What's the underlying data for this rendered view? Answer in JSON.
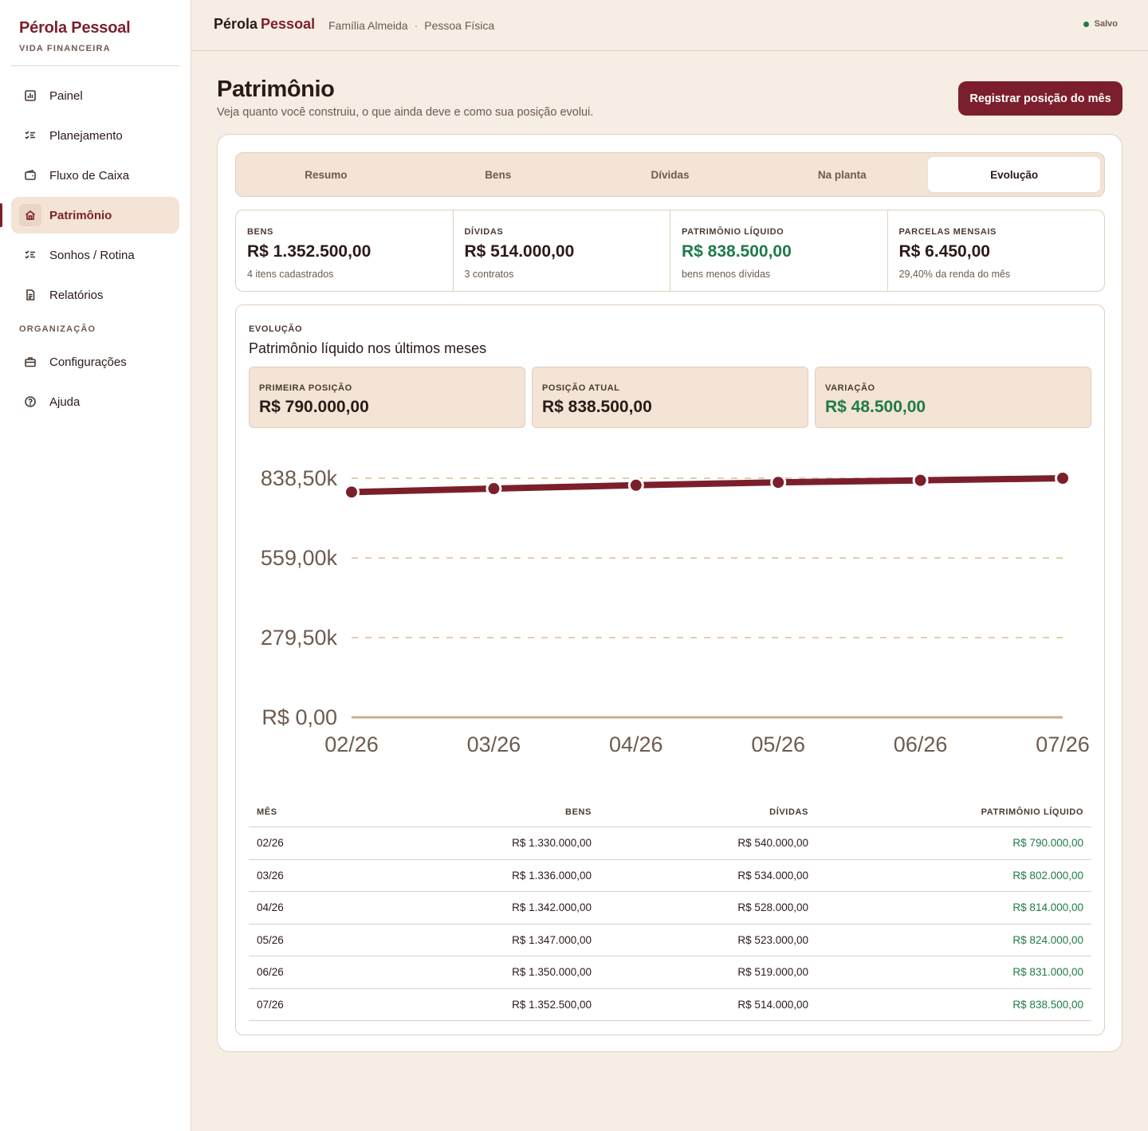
{
  "brand": {
    "name": "Pérola Pessoal",
    "subtitle": "VIDA FINANCEIRA"
  },
  "sidebar": {
    "items": [
      {
        "label": "Painel",
        "icon": "chart-bar-icon"
      },
      {
        "label": "Planejamento",
        "icon": "checklist-icon"
      },
      {
        "label": "Fluxo de Caixa",
        "icon": "wallet-icon"
      },
      {
        "label": "Patrimônio",
        "icon": "home-icon",
        "active": true
      },
      {
        "label": "Sonhos / Rotina",
        "icon": "checklist-icon"
      },
      {
        "label": "Relatórios",
        "icon": "document-icon"
      }
    ],
    "section_label": "ORGANIZAÇÃO",
    "org_items": [
      {
        "label": "Configurações",
        "icon": "briefcase-icon"
      },
      {
        "label": "Ajuda",
        "icon": "help-circle-icon"
      }
    ]
  },
  "topbar": {
    "title_part1": "Pérola",
    "title_part2": "Pessoal",
    "crumb1": "Família Almeida",
    "separator": "·",
    "crumb2": "Pessoa Física",
    "status": "Salvo"
  },
  "page": {
    "title": "Patrimônio",
    "subtitle": "Veja quanto você construiu, o que ainda deve e como sua posição evolui.",
    "primary_action": "Registrar posição do mês"
  },
  "tabs": [
    "Resumo",
    "Bens",
    "Dívidas",
    "Na planta",
    "Evolução"
  ],
  "active_tab": "Evolução",
  "kpis": [
    {
      "label": "BENS",
      "value": "R$ 1.352.500,00",
      "note": "4 itens cadastrados"
    },
    {
      "label": "DÍVIDAS",
      "value": "R$ 514.000,00",
      "note": "3 contratos"
    },
    {
      "label": "PATRIMÔNIO LÍQUIDO",
      "value": "R$ 838.500,00",
      "note": "bens menos dívidas"
    },
    {
      "label": "PARCELAS MENSAIS",
      "value": "R$ 6.450,00",
      "note": "29,40% da renda do mês"
    }
  ],
  "evolution": {
    "eyebrow": "EVOLUÇÃO",
    "title": "Patrimônio líquido nos últimos meses",
    "stats": [
      {
        "label": "PRIMEIRA POSIÇÃO",
        "value": "R$ 790.000,00"
      },
      {
        "label": "POSIÇÃO ATUAL",
        "value": "R$ 838.500,00"
      },
      {
        "label": "VARIAÇÃO",
        "value": "R$ 48.500,00"
      }
    ]
  },
  "colors": {
    "accent": "#7c1f2c",
    "positive": "#1f7a4a",
    "background": "#f6ede4",
    "surface_tint": "#f3e4d6",
    "gridline": "#e0cfbf",
    "axis": "#c9b08c"
  },
  "chart_data": {
    "type": "line",
    "x": [
      "02/26",
      "03/26",
      "04/26",
      "05/26",
      "06/26",
      "07/26"
    ],
    "series": [
      {
        "values": [
          790000,
          802000,
          814000,
          824000,
          831000,
          838500
        ]
      }
    ],
    "y_ticks": [
      "R$ 0,00",
      "279,50k",
      "559,00k",
      "838,50k"
    ],
    "y_tick_values": [
      0,
      279500,
      559000,
      838500
    ],
    "ylim": [
      0,
      838500
    ],
    "grid": true,
    "legend": "none"
  },
  "table": {
    "headers": [
      "MÊS",
      "BENS",
      "DÍVIDAS",
      "PATRIMÔNIO LÍQUIDO"
    ],
    "rows": [
      [
        "02/26",
        "R$ 1.330.000,00",
        "R$ 540.000,00",
        "R$ 790.000,00"
      ],
      [
        "03/26",
        "R$ 1.336.000,00",
        "R$ 534.000,00",
        "R$ 802.000,00"
      ],
      [
        "04/26",
        "R$ 1.342.000,00",
        "R$ 528.000,00",
        "R$ 814.000,00"
      ],
      [
        "05/26",
        "R$ 1.347.000,00",
        "R$ 523.000,00",
        "R$ 824.000,00"
      ],
      [
        "06/26",
        "R$ 1.350.000,00",
        "R$ 519.000,00",
        "R$ 831.000,00"
      ],
      [
        "07/26",
        "R$ 1.352.500,00",
        "R$ 514.000,00",
        "R$ 838.500,00"
      ]
    ]
  }
}
